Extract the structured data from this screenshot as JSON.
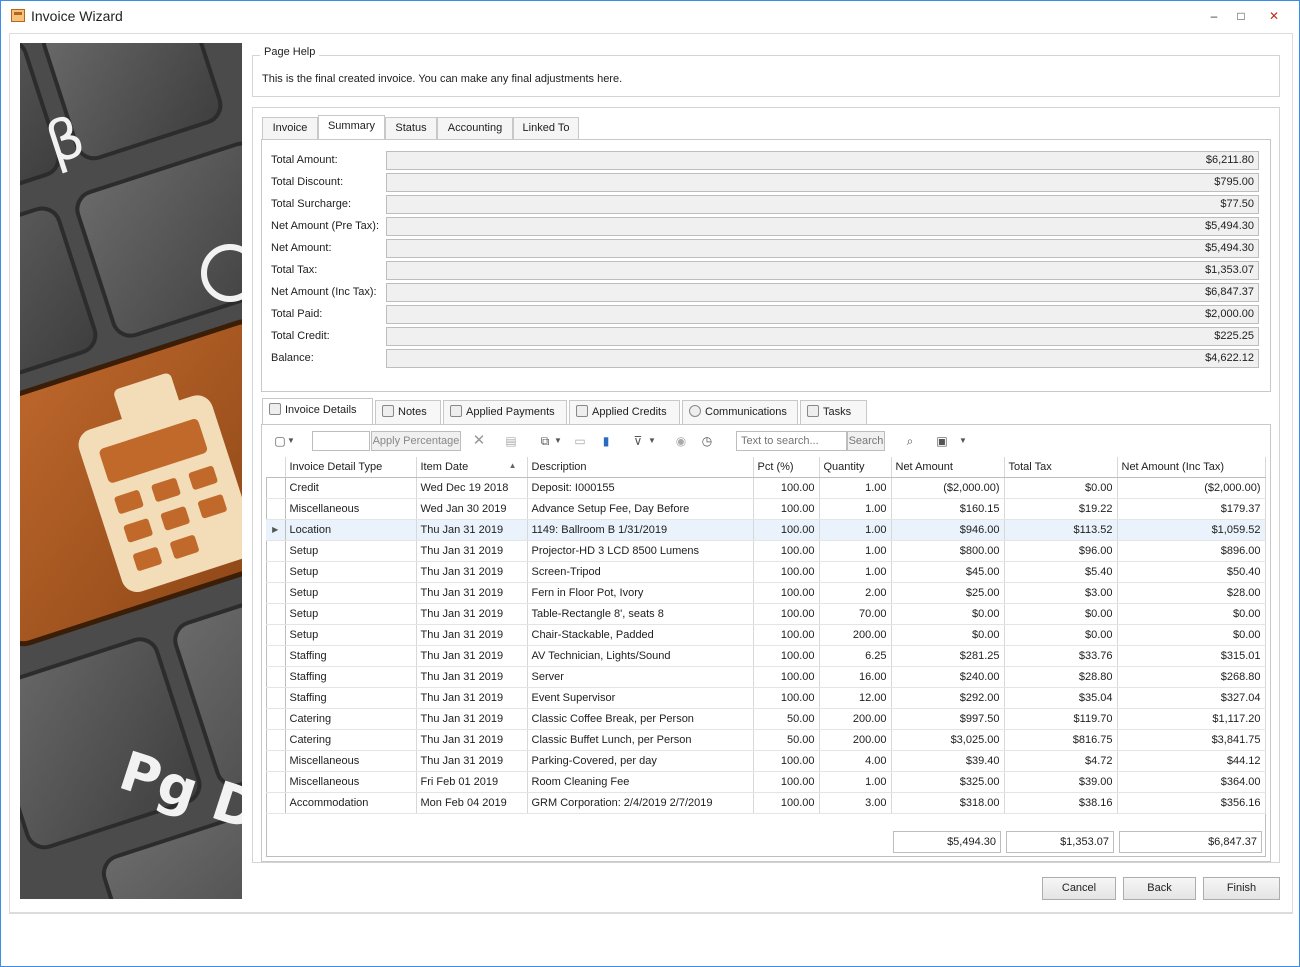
{
  "window": {
    "title": "Invoice Wizard",
    "minimize_glyph": "–",
    "maximize_glyph": "□",
    "close_glyph": "✕"
  },
  "page_help": {
    "legend": "Page Help",
    "text": "This is the final created invoice.  You can make any final adjustments here."
  },
  "top_tabs": [
    "Invoice",
    "Summary",
    "Status",
    "Accounting",
    "Linked To"
  ],
  "top_tabs_active": "Summary",
  "summary": [
    {
      "label": "Total Amount:",
      "value": "$6,211.80"
    },
    {
      "label": "Total Discount:",
      "value": "$795.00"
    },
    {
      "label": "Total Surcharge:",
      "value": "$77.50"
    },
    {
      "label": "Net Amount (Pre Tax):",
      "value": "$5,494.30"
    },
    {
      "label": "Net Amount:",
      "value": "$5,494.30"
    },
    {
      "label": "Total Tax:",
      "value": "$1,353.07"
    },
    {
      "label": "Net Amount (Inc Tax):",
      "value": "$6,847.37"
    },
    {
      "label": "Total Paid:",
      "value": "$2,000.00"
    },
    {
      "label": "Total Credit:",
      "value": "$225.25"
    },
    {
      "label": "Balance:",
      "value": "$4,622.12"
    }
  ],
  "detail_tabs": [
    "Invoice Details",
    "Notes",
    "Applied Payments",
    "Applied Credits",
    "Communications",
    "Tasks"
  ],
  "toolbar": {
    "apply_percentage": "Apply Percentage",
    "search_placeholder": "Text to search...",
    "search_button": "Search"
  },
  "grid": {
    "columns": [
      "Invoice Detail Type",
      "Item Date",
      "Description",
      "Pct (%)",
      "Quantity",
      "Net Amount",
      "Total Tax",
      "Net Amount (Inc Tax)"
    ],
    "selected_row": 2,
    "rows": [
      [
        "Credit",
        "Wed Dec 19 2018",
        "Deposit: I000155",
        "100.00",
        "1.00",
        "($2,000.00)",
        "$0.00",
        "($2,000.00)"
      ],
      [
        "Miscellaneous",
        "Wed Jan 30 2019",
        "Advance Setup Fee, Day Before",
        "100.00",
        "1.00",
        "$160.15",
        "$19.22",
        "$179.37"
      ],
      [
        "Location",
        "Thu Jan 31 2019",
        "1149: Ballroom B 1/31/2019",
        "100.00",
        "1.00",
        "$946.00",
        "$113.52",
        "$1,059.52"
      ],
      [
        "Setup",
        "Thu Jan 31 2019",
        "Projector-HD 3 LCD 8500 Lumens",
        "100.00",
        "1.00",
        "$800.00",
        "$96.00",
        "$896.00"
      ],
      [
        "Setup",
        "Thu Jan 31 2019",
        "Screen-Tripod",
        "100.00",
        "1.00",
        "$45.00",
        "$5.40",
        "$50.40"
      ],
      [
        "Setup",
        "Thu Jan 31 2019",
        "Fern in Floor Pot, Ivory",
        "100.00",
        "2.00",
        "$25.00",
        "$3.00",
        "$28.00"
      ],
      [
        "Setup",
        "Thu Jan 31 2019",
        "Table-Rectangle 8', seats 8",
        "100.00",
        "70.00",
        "$0.00",
        "$0.00",
        "$0.00"
      ],
      [
        "Setup",
        "Thu Jan 31 2019",
        "Chair-Stackable, Padded",
        "100.00",
        "200.00",
        "$0.00",
        "$0.00",
        "$0.00"
      ],
      [
        "Staffing",
        "Thu Jan 31 2019",
        "AV Technician, Lights/Sound",
        "100.00",
        "6.25",
        "$281.25",
        "$33.76",
        "$315.01"
      ],
      [
        "Staffing",
        "Thu Jan 31 2019",
        "Server",
        "100.00",
        "16.00",
        "$240.00",
        "$28.80",
        "$268.80"
      ],
      [
        "Staffing",
        "Thu Jan 31 2019",
        "Event Supervisor",
        "100.00",
        "12.00",
        "$292.00",
        "$35.04",
        "$327.04"
      ],
      [
        "Catering",
        "Thu Jan 31 2019",
        "Classic Coffee Break, per Person",
        "50.00",
        "200.00",
        "$997.50",
        "$119.70",
        "$1,117.20"
      ],
      [
        "Catering",
        "Thu Jan 31 2019",
        "Classic Buffet Lunch, per Person",
        "50.00",
        "200.00",
        "$3,025.00",
        "$816.75",
        "$3,841.75"
      ],
      [
        "Miscellaneous",
        "Thu Jan 31 2019",
        "Parking-Covered, per day",
        "100.00",
        "4.00",
        "$39.40",
        "$4.72",
        "$44.12"
      ],
      [
        "Miscellaneous",
        "Fri Feb 01 2019",
        "Room Cleaning Fee",
        "100.00",
        "1.00",
        "$325.00",
        "$39.00",
        "$364.00"
      ],
      [
        "Accommodation",
        "Mon Feb 04 2019",
        "GRM Corporation: 2/4/2019 2/7/2019",
        "100.00",
        "3.00",
        "$318.00",
        "$38.16",
        "$356.16"
      ]
    ],
    "totals": {
      "net_amount": "$5,494.30",
      "total_tax": "$1,353.07",
      "net_inc_tax": "$6,847.37"
    }
  },
  "buttons": {
    "cancel": "Cancel",
    "back": "Back",
    "finish": "Finish"
  }
}
